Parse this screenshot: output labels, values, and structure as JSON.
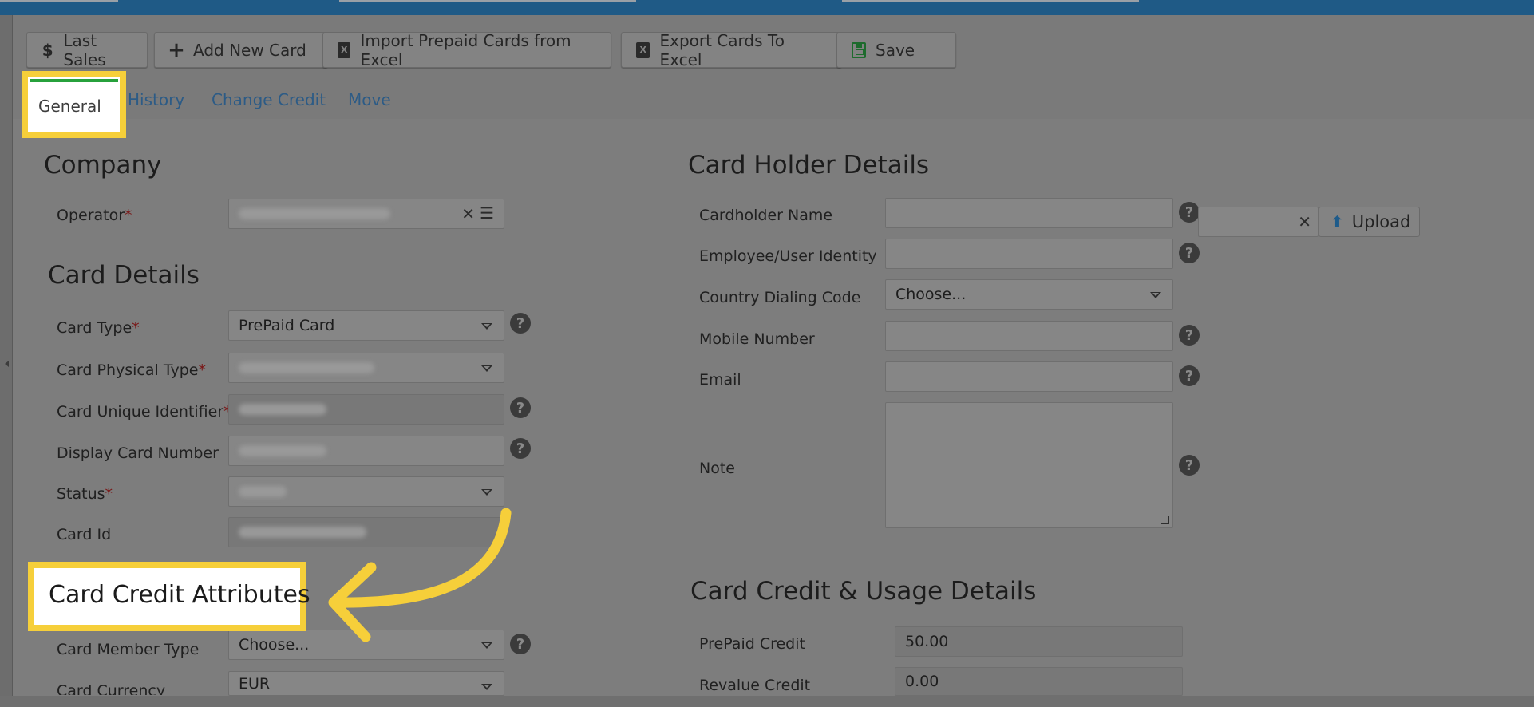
{
  "toolbar": {
    "last_sales": "Last Sales",
    "add_new_card": "Add New Card",
    "import_prepaid": "Import Prepaid Cards from Excel",
    "export_cards": "Export Cards To Excel",
    "save": "Save"
  },
  "tabs": {
    "general": "General",
    "history": "History",
    "change_credit": "Change Credit",
    "move": "Move"
  },
  "company": {
    "title": "Company",
    "operator_label": "Operator"
  },
  "card_details": {
    "title": "Card Details",
    "card_type_label": "Card Type",
    "card_type_value": "PrePaid Card",
    "card_physical_type_label": "Card Physical Type",
    "card_unique_identifier_label": "Card Unique Identifier",
    "display_card_number_label": "Display Card Number",
    "status_label": "Status",
    "card_id_label": "Card Id"
  },
  "card_credit_attributes": {
    "title": "Card Credit Attributes",
    "card_member_type_label": "Card Member Type",
    "card_member_type_value": "Choose...",
    "card_currency_label": "Card Currency",
    "card_currency_value": "EUR"
  },
  "card_holder": {
    "title": "Card Holder Details",
    "cardholder_name_label": "Cardholder Name",
    "employee_identity_label": "Employee/User Identity",
    "country_dialing_code_label": "Country Dialing Code",
    "country_dialing_code_value": "Choose...",
    "mobile_number_label": "Mobile Number",
    "email_label": "Email",
    "note_label": "Note",
    "upload_label": "Upload"
  },
  "credit_usage": {
    "title": "Card Credit & Usage Details",
    "prepaid_credit_label": "PrePaid Credit",
    "prepaid_credit_value": "50.00",
    "revalue_credit_label": "Revalue Credit",
    "revalue_credit_value": "0.00"
  },
  "icons": {
    "dollar": "$",
    "plus": "+",
    "excel": "X",
    "help": "?",
    "clear": "✕",
    "list": "☰",
    "upload": "⬆",
    "required": "*"
  },
  "colors": {
    "highlight": "#f6cf3a",
    "active_tab": "#27a13c",
    "link": "#2c5b86",
    "topbar": "#1f5a86"
  }
}
